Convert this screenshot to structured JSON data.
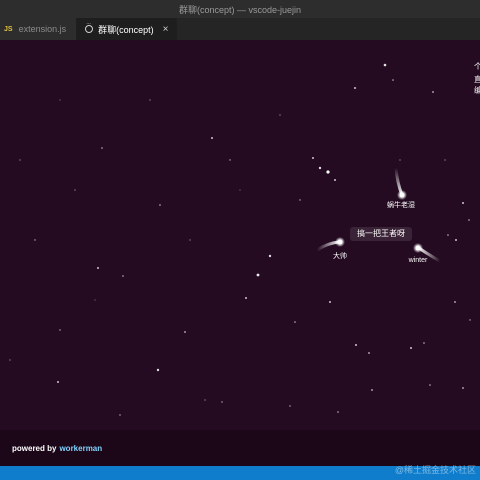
{
  "window": {
    "title": "群聊(concept) — vscode-juejin"
  },
  "tabs": [
    {
      "icon": "JS",
      "label": "extension.js"
    },
    {
      "icon": "chat-icon",
      "label": "群聊(concept)",
      "close": "×"
    }
  ],
  "stage": {
    "side_lines": [
      "个",
      "直",
      "编"
    ],
    "users": [
      {
        "name": "蜗牛老湿"
      },
      {
        "name": "大帅",
        "message": "搞一把王者呀"
      },
      {
        "name": "winter"
      }
    ]
  },
  "footer": {
    "prefix": "powered by",
    "brand": "workerman"
  },
  "watermark": "@稀土掘金技术社区",
  "colors": {
    "background": "#240b21",
    "statusbar": "#0f7dcc",
    "brand": "#7fd3ff"
  }
}
